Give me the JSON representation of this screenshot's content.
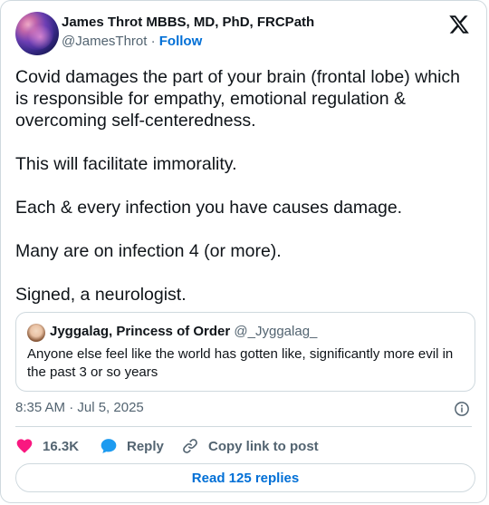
{
  "author": {
    "name": "James Throt MBBS, MD, PhD, FRCPath",
    "handle": "@JamesThrot",
    "separator": "·",
    "follow_label": "Follow"
  },
  "tweet": {
    "paragraphs": [
      "Covid damages the part of your brain (frontal lobe) which is responsible for empathy, emotional regulation & overcoming self-centeredness.",
      "This will facilitate immorality.",
      "Each & every infection you have causes damage.",
      "Many are on infection 4 (or more).",
      "Signed, a neurologist."
    ]
  },
  "quote": {
    "name": "Jyggalag, Princess of Order",
    "handle": "@_Jyggalag_",
    "text": "Anyone else feel like the world has gotten like, significantly more evil in the past 3 or so years"
  },
  "meta": {
    "timestamp": "8:35 AM · Jul 5, 2025"
  },
  "actions": {
    "likes": "16.3K",
    "reply_label": "Reply",
    "copy_label": "Copy link to post"
  },
  "footer": {
    "read_replies_label": "Read 125 replies"
  },
  "colors": {
    "accent": "#006fd6",
    "like": "#f91880",
    "reply": "#1d9bf0",
    "muted": "#536471",
    "border": "#cfd9de"
  },
  "icons": [
    "x-logo-icon",
    "info-icon",
    "heart-icon",
    "reply-bubble-icon",
    "link-icon"
  ]
}
